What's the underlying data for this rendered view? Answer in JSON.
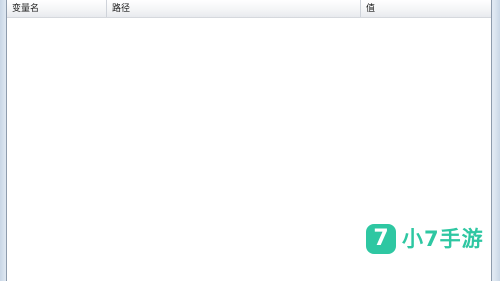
{
  "columns": {
    "name": "变量名",
    "path": "路径",
    "value": "值"
  },
  "rows": [],
  "watermark": {
    "logo_glyph": "7",
    "text": "小7手游",
    "color": "#2ec7a2"
  }
}
